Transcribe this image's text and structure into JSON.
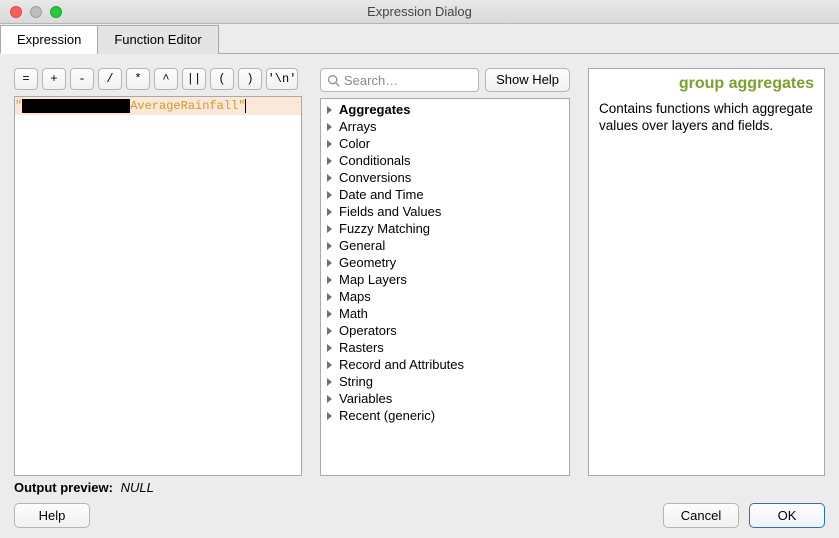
{
  "window": {
    "title": "Expression Dialog"
  },
  "tabs": {
    "expression": "Expression",
    "function_editor": "Function Editor"
  },
  "operators": [
    "=",
    "+",
    "-",
    "/",
    "*",
    "^",
    "||",
    "(",
    ")",
    "'\\n'"
  ],
  "editor": {
    "quote_open": "\"",
    "field": "AverageRainfall",
    "quote_close": "\""
  },
  "search": {
    "placeholder": "Search…"
  },
  "buttons": {
    "show_help": "Show Help",
    "help": "Help",
    "cancel": "Cancel",
    "ok": "OK"
  },
  "tree": [
    "Aggregates",
    "Arrays",
    "Color",
    "Conditionals",
    "Conversions",
    "Date and Time",
    "Fields and Values",
    "Fuzzy Matching",
    "General",
    "Geometry",
    "Map Layers",
    "Maps",
    "Math",
    "Operators",
    "Rasters",
    "Record and Attributes",
    "String",
    "Variables",
    "Recent (generic)"
  ],
  "help": {
    "title": "group aggregates",
    "body": "Contains functions which aggregate values over layers and fields."
  },
  "preview": {
    "label": "Output preview:",
    "value": "NULL"
  }
}
